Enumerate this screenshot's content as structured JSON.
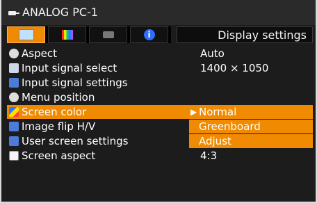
{
  "header": {
    "source_title": "ANALOG PC-1",
    "menu_title": "Display settings"
  },
  "tabs": [
    {
      "icon": "display-icon",
      "active": true
    },
    {
      "icon": "color-bars-icon",
      "active": false
    },
    {
      "icon": "projector-icon",
      "active": false
    },
    {
      "icon": "info-icon",
      "active": false
    }
  ],
  "menu_items": [
    {
      "label": "Aspect",
      "value": "Auto",
      "icon": "aspect-icon"
    },
    {
      "label": "Input signal select",
      "value": "1400 × 1050",
      "icon": "input-signal-icon"
    },
    {
      "label": "Input signal settings",
      "value": "",
      "icon": "input-settings-icon"
    },
    {
      "label": "Menu position",
      "value": "",
      "icon": "menu-position-icon"
    },
    {
      "label": "Screen color",
      "value": "",
      "icon": "screen-color-icon",
      "selected": true
    },
    {
      "label": "Image flip H/V",
      "value": "",
      "icon": "image-flip-icon"
    },
    {
      "label": "User screen settings",
      "value": "",
      "icon": "user-screen-icon"
    },
    {
      "label": "Screen aspect",
      "value": "4:3",
      "icon": "screen-aspect-icon"
    }
  ],
  "screen_color_options": [
    {
      "label": "Normal",
      "current": true
    },
    {
      "label": "Greenboard",
      "current": false
    },
    {
      "label": "Adjust",
      "current": false
    }
  ],
  "colors": {
    "accent": "#f08a00",
    "background": "#1c1c1c",
    "text": "#ffffff"
  }
}
